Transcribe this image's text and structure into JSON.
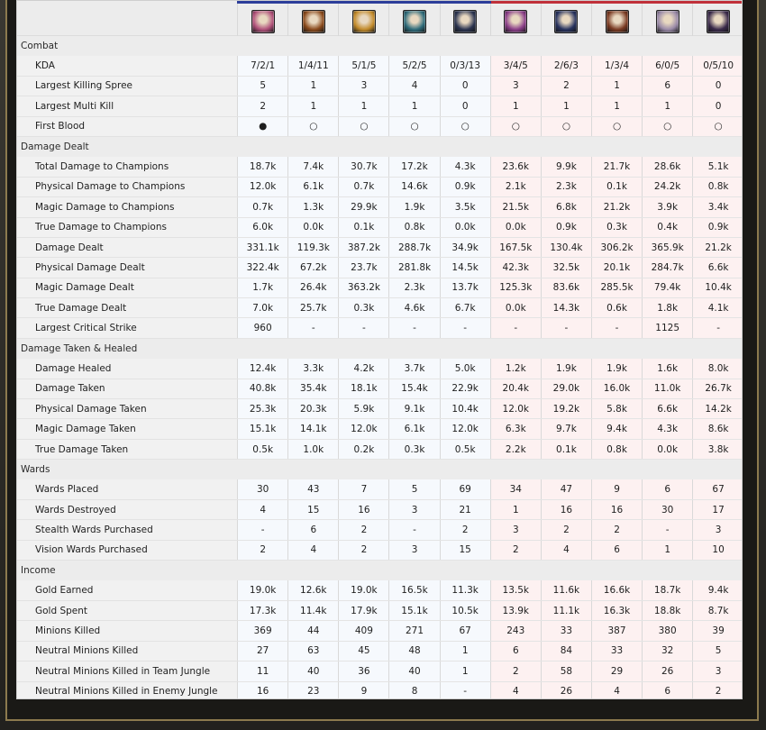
{
  "colors": {
    "blue_team": "#2c3e9a",
    "red_team": "#c0303a",
    "blue_cell": "#f6f9fd",
    "red_cell": "#fdf1f1"
  },
  "champions": [
    {
      "team": "blue",
      "portrait_color": "#b0517a",
      "icon": "champion-portrait"
    },
    {
      "team": "blue",
      "portrait_color": "#8a4a1c",
      "icon": "champion-portrait"
    },
    {
      "team": "blue",
      "portrait_color": "#c28a2a",
      "icon": "champion-portrait"
    },
    {
      "team": "blue",
      "portrait_color": "#2e6b7a",
      "icon": "champion-portrait"
    },
    {
      "team": "blue",
      "portrait_color": "#2b3450",
      "icon": "champion-portrait"
    },
    {
      "team": "red",
      "portrait_color": "#8a3e88",
      "icon": "champion-portrait"
    },
    {
      "team": "red",
      "portrait_color": "#27325e",
      "icon": "champion-portrait"
    },
    {
      "team": "red",
      "portrait_color": "#7a3a22",
      "icon": "champion-portrait"
    },
    {
      "team": "red",
      "portrait_color": "#9a8aa8",
      "icon": "champion-portrait"
    },
    {
      "team": "red",
      "portrait_color": "#3a2a4a",
      "icon": "champion-portrait"
    }
  ],
  "sections": [
    {
      "title": "Combat",
      "rows": [
        {
          "label": "KDA",
          "values": [
            "7/2/1",
            "1/4/11",
            "5/1/5",
            "5/2/5",
            "0/3/13",
            "3/4/5",
            "2/6/3",
            "1/3/4",
            "6/0/5",
            "0/5/10"
          ]
        },
        {
          "label": "Largest Killing Spree",
          "values": [
            "5",
            "1",
            "3",
            "4",
            "0",
            "3",
            "2",
            "1",
            "6",
            "0"
          ]
        },
        {
          "label": "Largest Multi Kill",
          "values": [
            "2",
            "1",
            "1",
            "1",
            "0",
            "1",
            "1",
            "1",
            "1",
            "0"
          ]
        },
        {
          "label": "First Blood",
          "values": [
            "●",
            "○",
            "○",
            "○",
            "○",
            "○",
            "○",
            "○",
            "○",
            "○"
          ]
        }
      ]
    },
    {
      "title": "Damage Dealt",
      "rows": [
        {
          "label": "Total Damage to Champions",
          "values": [
            "18.7k",
            "7.4k",
            "30.7k",
            "17.2k",
            "4.3k",
            "23.6k",
            "9.9k",
            "21.7k",
            "28.6k",
            "5.1k"
          ]
        },
        {
          "label": "Physical Damage to Champions",
          "values": [
            "12.0k",
            "6.1k",
            "0.7k",
            "14.6k",
            "0.9k",
            "2.1k",
            "2.3k",
            "0.1k",
            "24.2k",
            "0.8k"
          ]
        },
        {
          "label": "Magic Damage to Champions",
          "values": [
            "0.7k",
            "1.3k",
            "29.9k",
            "1.9k",
            "3.5k",
            "21.5k",
            "6.8k",
            "21.2k",
            "3.9k",
            "3.4k"
          ]
        },
        {
          "label": "True Damage to Champions",
          "values": [
            "6.0k",
            "0.0k",
            "0.1k",
            "0.8k",
            "0.0k",
            "0.0k",
            "0.9k",
            "0.3k",
            "0.4k",
            "0.9k"
          ]
        },
        {
          "label": "Damage Dealt",
          "values": [
            "331.1k",
            "119.3k",
            "387.2k",
            "288.7k",
            "34.9k",
            "167.5k",
            "130.4k",
            "306.2k",
            "365.9k",
            "21.2k"
          ]
        },
        {
          "label": "Physical Damage Dealt",
          "values": [
            "322.4k",
            "67.2k",
            "23.7k",
            "281.8k",
            "14.5k",
            "42.3k",
            "32.5k",
            "20.1k",
            "284.7k",
            "6.6k"
          ]
        },
        {
          "label": "Magic Damage Dealt",
          "values": [
            "1.7k",
            "26.4k",
            "363.2k",
            "2.3k",
            "13.7k",
            "125.3k",
            "83.6k",
            "285.5k",
            "79.4k",
            "10.4k"
          ]
        },
        {
          "label": "True Damage Dealt",
          "values": [
            "7.0k",
            "25.7k",
            "0.3k",
            "4.6k",
            "6.7k",
            "0.0k",
            "14.3k",
            "0.6k",
            "1.8k",
            "4.1k"
          ]
        },
        {
          "label": "Largest Critical Strike",
          "values": [
            "960",
            "-",
            "-",
            "-",
            "-",
            "-",
            "-",
            "-",
            "1125",
            "-"
          ]
        }
      ]
    },
    {
      "title": "Damage Taken & Healed",
      "rows": [
        {
          "label": "Damage Healed",
          "values": [
            "12.4k",
            "3.3k",
            "4.2k",
            "3.7k",
            "5.0k",
            "1.2k",
            "1.9k",
            "1.9k",
            "1.6k",
            "8.0k"
          ]
        },
        {
          "label": "Damage Taken",
          "values": [
            "40.8k",
            "35.4k",
            "18.1k",
            "15.4k",
            "22.9k",
            "20.4k",
            "29.0k",
            "16.0k",
            "11.0k",
            "26.7k"
          ]
        },
        {
          "label": "Physical Damage Taken",
          "values": [
            "25.3k",
            "20.3k",
            "5.9k",
            "9.1k",
            "10.4k",
            "12.0k",
            "19.2k",
            "5.8k",
            "6.6k",
            "14.2k"
          ]
        },
        {
          "label": "Magic Damage Taken",
          "values": [
            "15.1k",
            "14.1k",
            "12.0k",
            "6.1k",
            "12.0k",
            "6.3k",
            "9.7k",
            "9.4k",
            "4.3k",
            "8.6k"
          ]
        },
        {
          "label": "True Damage Taken",
          "values": [
            "0.5k",
            "1.0k",
            "0.2k",
            "0.3k",
            "0.5k",
            "2.2k",
            "0.1k",
            "0.8k",
            "0.0k",
            "3.8k"
          ]
        }
      ]
    },
    {
      "title": "Wards",
      "rows": [
        {
          "label": "Wards Placed",
          "values": [
            "30",
            "43",
            "7",
            "5",
            "69",
            "34",
            "47",
            "9",
            "6",
            "67"
          ]
        },
        {
          "label": "Wards Destroyed",
          "values": [
            "4",
            "15",
            "16",
            "3",
            "21",
            "1",
            "16",
            "16",
            "30",
            "17"
          ]
        },
        {
          "label": "Stealth Wards Purchased",
          "values": [
            "-",
            "6",
            "2",
            "-",
            "2",
            "3",
            "2",
            "2",
            "-",
            "3"
          ]
        },
        {
          "label": "Vision Wards Purchased",
          "values": [
            "2",
            "4",
            "2",
            "3",
            "15",
            "2",
            "4",
            "6",
            "1",
            "10"
          ]
        }
      ]
    },
    {
      "title": "Income",
      "rows": [
        {
          "label": "Gold Earned",
          "values": [
            "19.0k",
            "12.6k",
            "19.0k",
            "16.5k",
            "11.3k",
            "13.5k",
            "11.6k",
            "16.6k",
            "18.7k",
            "9.4k"
          ]
        },
        {
          "label": "Gold Spent",
          "values": [
            "17.3k",
            "11.4k",
            "17.9k",
            "15.1k",
            "10.5k",
            "13.9k",
            "11.1k",
            "16.3k",
            "18.8k",
            "8.7k"
          ]
        },
        {
          "label": "Minions Killed",
          "values": [
            "369",
            "44",
            "409",
            "271",
            "67",
            "243",
            "33",
            "387",
            "380",
            "39"
          ]
        },
        {
          "label": "Neutral Minions Killed",
          "values": [
            "27",
            "63",
            "45",
            "48",
            "1",
            "6",
            "84",
            "33",
            "32",
            "5"
          ]
        },
        {
          "label": "Neutral Minions Killed in Team Jungle",
          "values": [
            "11",
            "40",
            "36",
            "40",
            "1",
            "2",
            "58",
            "29",
            "26",
            "3"
          ]
        },
        {
          "label": "Neutral Minions Killed in Enemy Jungle",
          "values": [
            "16",
            "23",
            "9",
            "8",
            "-",
            "4",
            "26",
            "4",
            "6",
            "2"
          ]
        }
      ]
    }
  ]
}
